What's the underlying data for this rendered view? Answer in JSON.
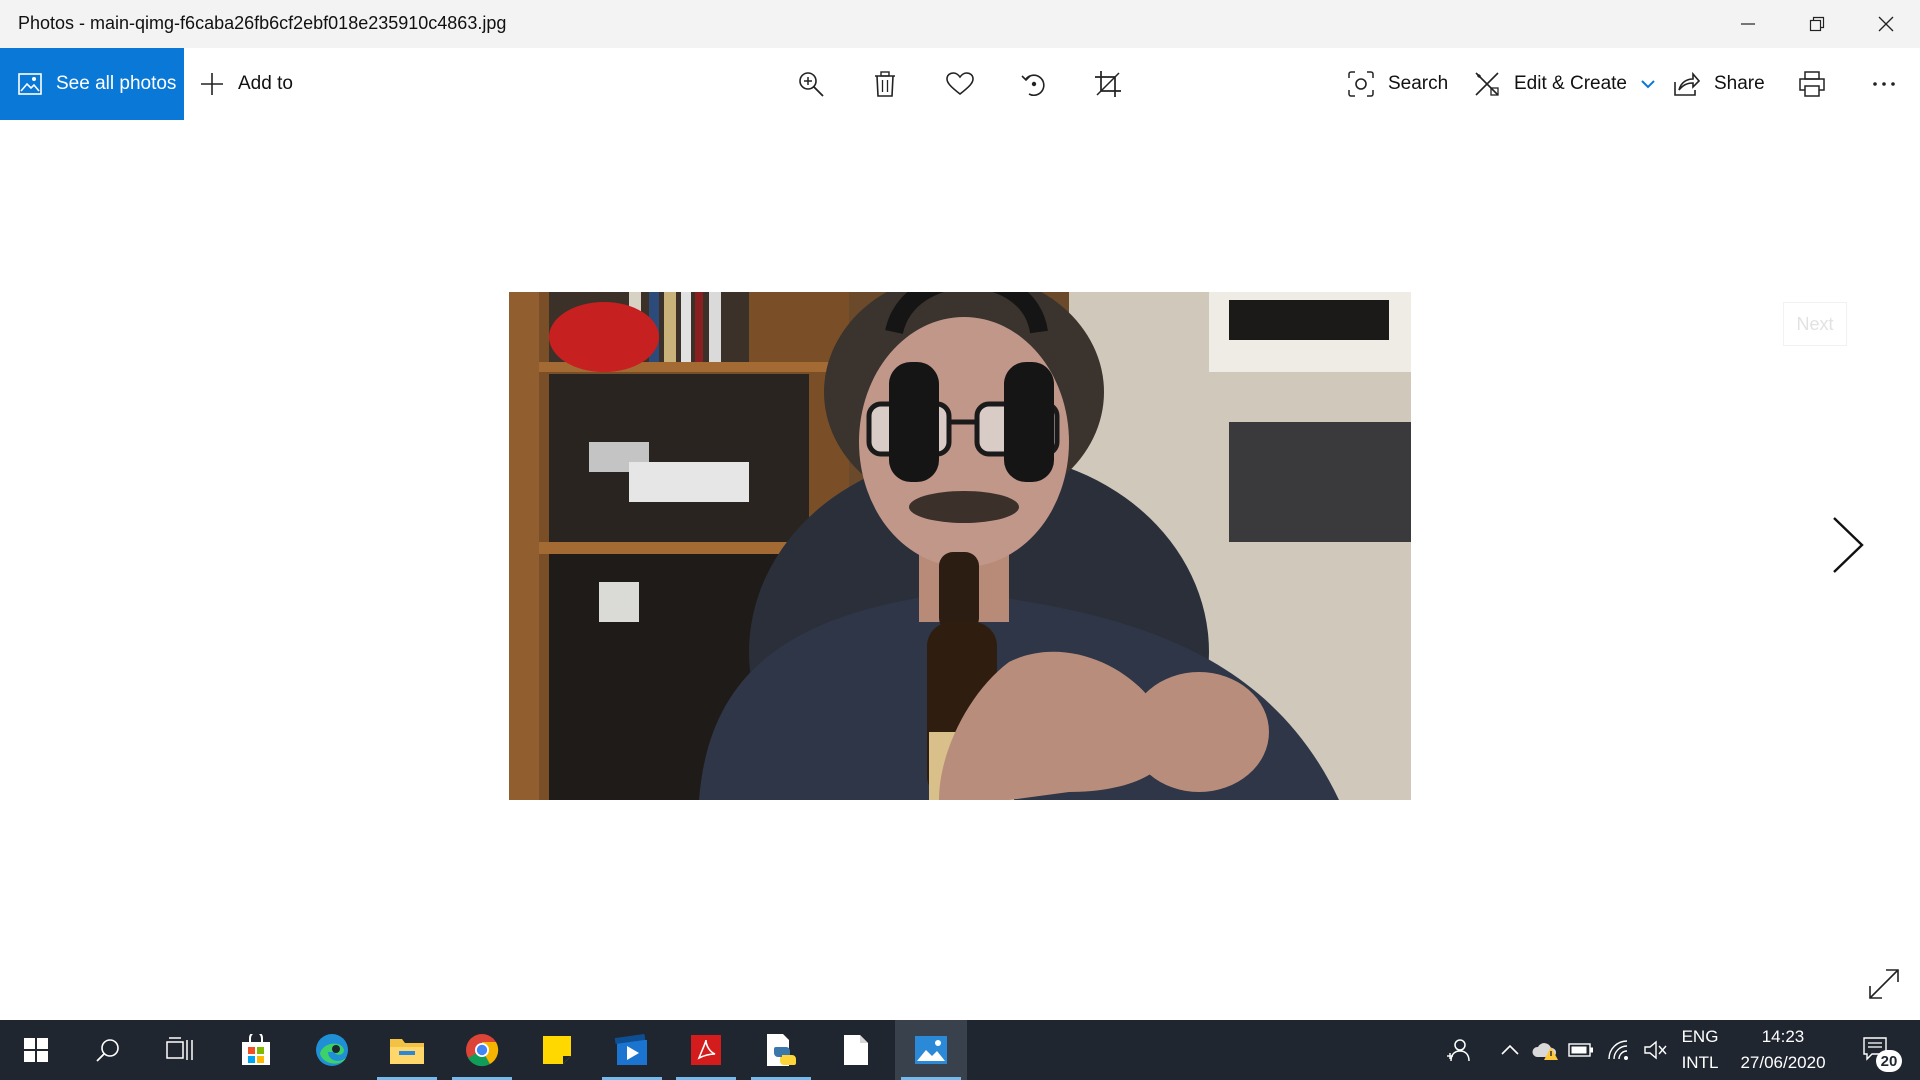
{
  "window": {
    "title": "Photos - main-qimg-f6caba26fb6cf2ebf018e235910c4863.jpg"
  },
  "toolbar": {
    "see_all_photos": "See all photos",
    "add_to": "Add to",
    "search": "Search",
    "edit_create": "Edit & Create",
    "share": "Share"
  },
  "viewer": {
    "next_tooltip": "Next"
  },
  "taskbar": {
    "language_top": "ENG",
    "language_bottom": "INTL",
    "time": "14:23",
    "date": "27/06/2020",
    "notification_count": "20"
  },
  "colors": {
    "accent": "#0a78d7",
    "taskbar": "#1f2630"
  }
}
